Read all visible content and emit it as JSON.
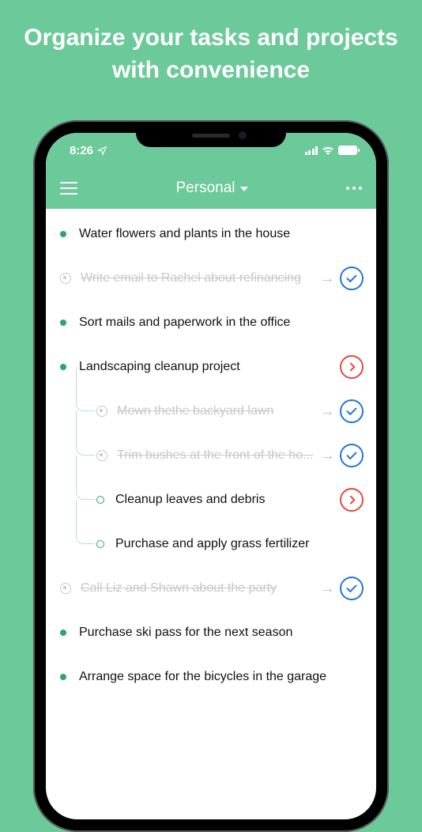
{
  "marketing": {
    "title": "Organize your tasks and projects with convenience"
  },
  "status_bar": {
    "time": "8:26"
  },
  "nav": {
    "title": "Personal"
  },
  "tasks": [
    {
      "text": "Water flowers and plants in the house",
      "level": 0,
      "completed": false,
      "action": null
    },
    {
      "text": "Write email to Rachel about refinancing",
      "level": 0,
      "completed": true,
      "action": "check"
    },
    {
      "text": "Sort mails and paperwork in the office",
      "level": 0,
      "completed": false,
      "action": null
    },
    {
      "text": "Landscaping cleanup project",
      "level": 0,
      "completed": false,
      "action": "expand"
    },
    {
      "text": "Mown thethe backyard lawn",
      "level": 1,
      "completed": true,
      "action": "check"
    },
    {
      "text": "Trim bushes at the front of the ho...",
      "level": 1,
      "completed": true,
      "action": "check"
    },
    {
      "text": "Cleanup leaves and debris",
      "level": 1,
      "completed": false,
      "action": "expand"
    },
    {
      "text": "Purchase and apply grass fertilizer",
      "level": 1,
      "completed": false,
      "action": null
    },
    {
      "text": "Call Liz and Shawn about the party",
      "level": 0,
      "completed": true,
      "action": "check"
    },
    {
      "text": "Purchase ski pass for the next season",
      "level": 0,
      "completed": false,
      "action": null
    },
    {
      "text": "Arrange space for the bicycles in the garage",
      "level": 0,
      "completed": false,
      "action": null
    }
  ]
}
